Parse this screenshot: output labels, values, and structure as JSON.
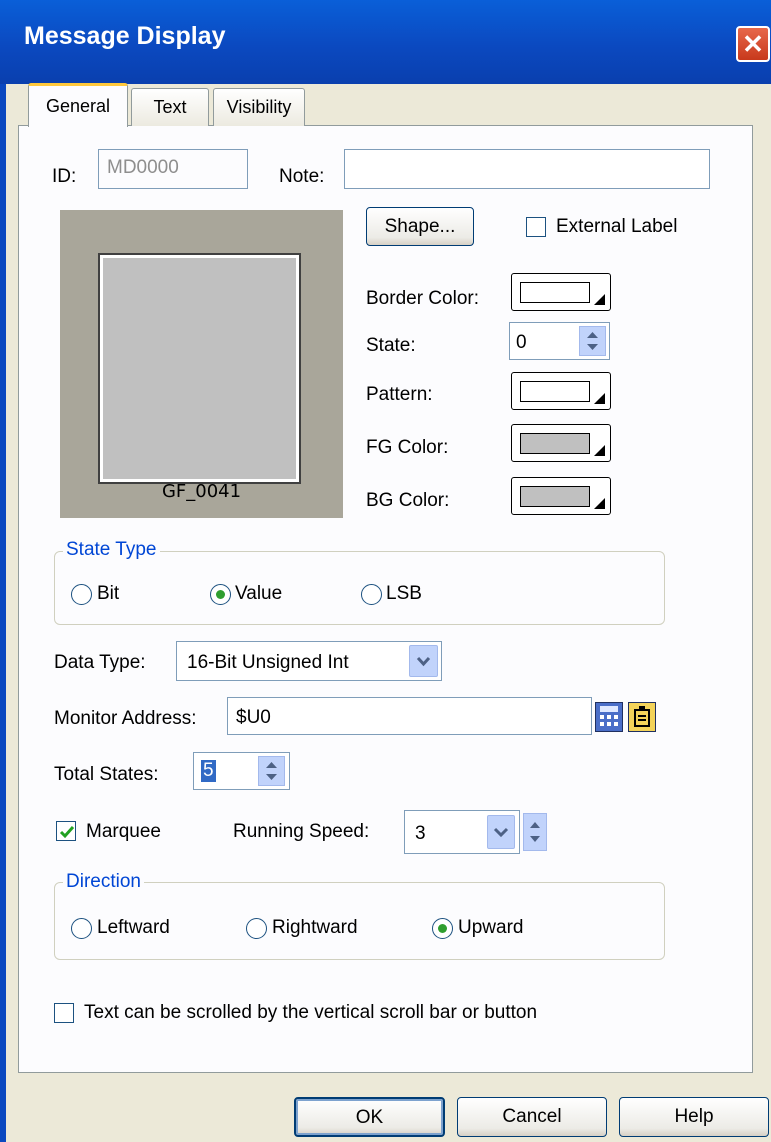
{
  "window": {
    "title": "Message Display",
    "close_glyph": "✕"
  },
  "tabs": [
    {
      "label": "General"
    },
    {
      "label": "Text"
    },
    {
      "label": "Visibility"
    }
  ],
  "id_field": {
    "label": "ID:",
    "value": "MD0000"
  },
  "note_field": {
    "label": "Note:",
    "value": ""
  },
  "preview": {
    "caption": "GF_0041"
  },
  "shape_button": {
    "label": "Shape..."
  },
  "external_label": {
    "label": "External Label",
    "checked": false
  },
  "properties": {
    "border_color_label": "Border Color:",
    "state_label": "State:",
    "state_value": "0",
    "pattern_label": "Pattern:",
    "fg_color_label": "FG Color:",
    "bg_color_label": "BG Color:"
  },
  "colors": {
    "border": "#ffffff",
    "pattern": "#ffffff",
    "fg": "#c0c0c0",
    "bg": "#c0c0c0",
    "preview_bg": "#a9a69a",
    "preview_face": "#c0c0c0"
  },
  "state_type": {
    "title": "State Type",
    "options": [
      {
        "label": "Bit",
        "selected": false
      },
      {
        "label": "Value",
        "selected": true
      },
      {
        "label": "LSB",
        "selected": false
      }
    ]
  },
  "data_type": {
    "label": "Data Type:",
    "value": "16-Bit Unsigned Int"
  },
  "monitor_address": {
    "label": "Monitor Address:",
    "value": "$U0"
  },
  "total_states": {
    "label": "Total States:",
    "value": "5"
  },
  "marquee": {
    "label": "Marquee",
    "checked": true
  },
  "running_speed": {
    "label": "Running Speed:",
    "value": "3"
  },
  "direction": {
    "title": "Direction",
    "options": [
      {
        "label": "Leftward",
        "selected": false
      },
      {
        "label": "Rightward",
        "selected": false
      },
      {
        "label": "Upward",
        "selected": true
      }
    ]
  },
  "scroll_option": {
    "label": "Text can be scrolled by the vertical scroll bar or button",
    "checked": false
  },
  "buttons": {
    "ok": "OK",
    "cancel": "Cancel",
    "help": "Help"
  }
}
